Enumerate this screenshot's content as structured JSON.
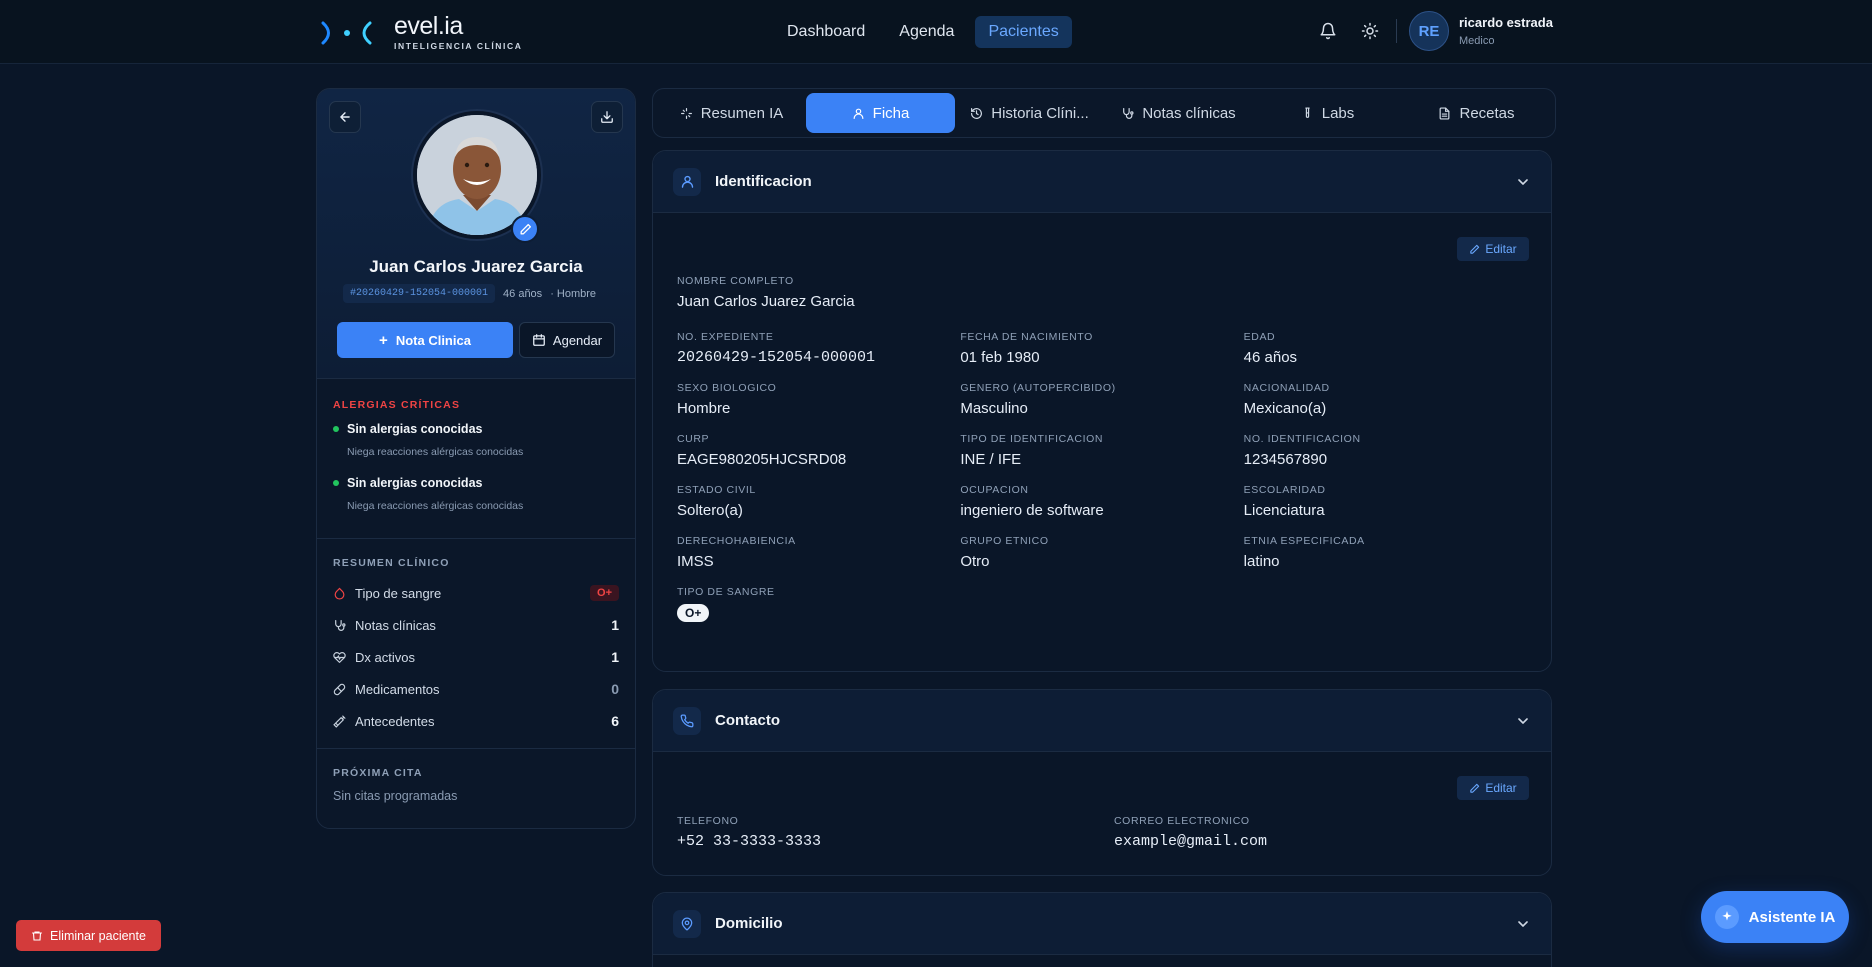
{
  "brand": {
    "name": "evel.ia",
    "subtitle": "INTELIGENCIA CLÍNICA"
  },
  "nav": [
    {
      "label": "Dashboard",
      "active": false
    },
    {
      "label": "Agenda",
      "active": false
    },
    {
      "label": "Pacientes",
      "active": true
    }
  ],
  "user": {
    "initials": "RE",
    "name": "ricardo estrada",
    "role": "Medico"
  },
  "patient": {
    "name": "Juan Carlos Juarez Garcia",
    "id": "#20260429-152054-000001",
    "age": "46 años",
    "sex": "· Hombre",
    "primary_action": "Nota Clinica",
    "secondary_action": "Agendar"
  },
  "allergies": {
    "title": "ALERGIAS CRÍTICAS",
    "items": [
      {
        "name": "Sin alergias conocidas",
        "note": "Niega reacciones alérgicas conocidas"
      },
      {
        "name": "Sin alergias conocidas",
        "note": "Niega reacciones alérgicas conocidas"
      }
    ]
  },
  "summary": {
    "title": "RESUMEN CLÍNICO",
    "blood_label": "Tipo de sangre",
    "blood_value": "O+",
    "stats": [
      {
        "label": "Notas clínicas",
        "value": "1"
      },
      {
        "label": "Dx activos",
        "value": "1"
      },
      {
        "label": "Medicamentos",
        "value": "0"
      },
      {
        "label": "Antecedentes",
        "value": "6"
      }
    ]
  },
  "next_appointment": {
    "title": "PRÓXIMA CITA",
    "value": "Sin citas programadas"
  },
  "tabs": [
    {
      "label": "Resumen IA",
      "icon": "sparkle-icon"
    },
    {
      "label": "Ficha",
      "icon": "user-icon",
      "active": true
    },
    {
      "label": "Historia Clíni...",
      "icon": "history-icon"
    },
    {
      "label": "Notas clínicas",
      "icon": "stethoscope-icon"
    },
    {
      "label": "Labs",
      "icon": "test-tube-icon"
    },
    {
      "label": "Recetas",
      "icon": "document-icon"
    }
  ],
  "identification": {
    "title": "Identificacion",
    "edit": "Editar",
    "full_name_label": "NOMBRE COMPLETO",
    "full_name": "Juan Carlos Juarez Garcia",
    "fields": [
      {
        "label": "NO. EXPEDIENTE",
        "value": "20260429-152054-000001",
        "mono": true
      },
      {
        "label": "FECHA DE NACIMIENTO",
        "value": "01 feb 1980"
      },
      {
        "label": "EDAD",
        "value": "46 años"
      },
      {
        "label": "SEXO BIOLOGICO",
        "value": "Hombre"
      },
      {
        "label": "GENERO (AUTOPERCIBIDO)",
        "value": "Masculino"
      },
      {
        "label": "NACIONALIDAD",
        "value": "Mexicano(a)"
      },
      {
        "label": "CURP",
        "value": "EAGE980205HJCSRD08"
      },
      {
        "label": "TIPO DE IDENTIFICACION",
        "value": "INE / IFE"
      },
      {
        "label": "NO. IDENTIFICACION",
        "value": "1234567890"
      },
      {
        "label": "ESTADO CIVIL",
        "value": "Soltero(a)"
      },
      {
        "label": "OCUPACION",
        "value": "ingeniero de software"
      },
      {
        "label": "ESCOLARIDAD",
        "value": "Licenciatura"
      },
      {
        "label": "DERECHOHABIENCIA",
        "value": "IMSS"
      },
      {
        "label": "GRUPO ETNICO",
        "value": "Otro"
      },
      {
        "label": "ETNIA ESPECIFICADA",
        "value": "latino"
      }
    ],
    "blood_label": "TIPO DE SANGRE",
    "blood_value": "O+"
  },
  "contact": {
    "title": "Contacto",
    "edit": "Editar",
    "phone_label": "TELEFONO",
    "phone": "+52 33-3333-3333",
    "email_label": "CORREO ELECTRONICO",
    "email": "example@gmail.com"
  },
  "address": {
    "title": "Domicilio"
  },
  "assistant": {
    "label": "Asistente IA"
  },
  "delete": {
    "label": "Eliminar paciente"
  },
  "colors": {
    "accent": "#3b82f6",
    "danger": "#d33b3b",
    "background": "#0a1628"
  }
}
